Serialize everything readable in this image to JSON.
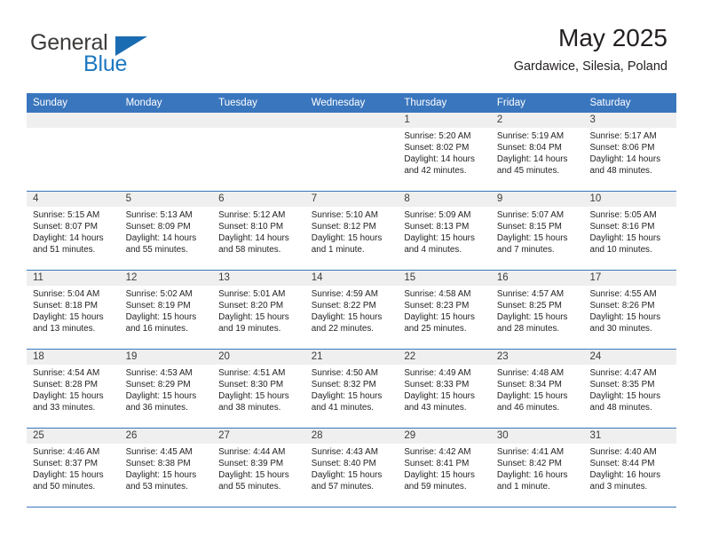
{
  "logo": {
    "word_one": "General",
    "word_two": "Blue",
    "icon": "blue-triangle"
  },
  "header": {
    "title": "May 2025",
    "subtitle": "Gardawice, Silesia, Poland"
  },
  "colors": {
    "header_blue": "#3a76bd",
    "date_band_gray": "#efefef",
    "logo_blue": "#1d78c1",
    "text": "#231f20"
  },
  "weekdays": [
    "Sunday",
    "Monday",
    "Tuesday",
    "Wednesday",
    "Thursday",
    "Friday",
    "Saturday"
  ],
  "weeks": [
    [
      {
        "day": "",
        "empty": true
      },
      {
        "day": "",
        "empty": true
      },
      {
        "day": "",
        "empty": true
      },
      {
        "day": "",
        "empty": true
      },
      {
        "day": "1",
        "sunrise": "Sunrise: 5:20 AM",
        "sunset": "Sunset: 8:02 PM",
        "daylight1": "Daylight: 14 hours",
        "daylight2": "and 42 minutes."
      },
      {
        "day": "2",
        "sunrise": "Sunrise: 5:19 AM",
        "sunset": "Sunset: 8:04 PM",
        "daylight1": "Daylight: 14 hours",
        "daylight2": "and 45 minutes."
      },
      {
        "day": "3",
        "sunrise": "Sunrise: 5:17 AM",
        "sunset": "Sunset: 8:06 PM",
        "daylight1": "Daylight: 14 hours",
        "daylight2": "and 48 minutes."
      }
    ],
    [
      {
        "day": "4",
        "sunrise": "Sunrise: 5:15 AM",
        "sunset": "Sunset: 8:07 PM",
        "daylight1": "Daylight: 14 hours",
        "daylight2": "and 51 minutes."
      },
      {
        "day": "5",
        "sunrise": "Sunrise: 5:13 AM",
        "sunset": "Sunset: 8:09 PM",
        "daylight1": "Daylight: 14 hours",
        "daylight2": "and 55 minutes."
      },
      {
        "day": "6",
        "sunrise": "Sunrise: 5:12 AM",
        "sunset": "Sunset: 8:10 PM",
        "daylight1": "Daylight: 14 hours",
        "daylight2": "and 58 minutes."
      },
      {
        "day": "7",
        "sunrise": "Sunrise: 5:10 AM",
        "sunset": "Sunset: 8:12 PM",
        "daylight1": "Daylight: 15 hours",
        "daylight2": "and 1 minute."
      },
      {
        "day": "8",
        "sunrise": "Sunrise: 5:09 AM",
        "sunset": "Sunset: 8:13 PM",
        "daylight1": "Daylight: 15 hours",
        "daylight2": "and 4 minutes."
      },
      {
        "day": "9",
        "sunrise": "Sunrise: 5:07 AM",
        "sunset": "Sunset: 8:15 PM",
        "daylight1": "Daylight: 15 hours",
        "daylight2": "and 7 minutes."
      },
      {
        "day": "10",
        "sunrise": "Sunrise: 5:05 AM",
        "sunset": "Sunset: 8:16 PM",
        "daylight1": "Daylight: 15 hours",
        "daylight2": "and 10 minutes."
      }
    ],
    [
      {
        "day": "11",
        "sunrise": "Sunrise: 5:04 AM",
        "sunset": "Sunset: 8:18 PM",
        "daylight1": "Daylight: 15 hours",
        "daylight2": "and 13 minutes."
      },
      {
        "day": "12",
        "sunrise": "Sunrise: 5:02 AM",
        "sunset": "Sunset: 8:19 PM",
        "daylight1": "Daylight: 15 hours",
        "daylight2": "and 16 minutes."
      },
      {
        "day": "13",
        "sunrise": "Sunrise: 5:01 AM",
        "sunset": "Sunset: 8:20 PM",
        "daylight1": "Daylight: 15 hours",
        "daylight2": "and 19 minutes."
      },
      {
        "day": "14",
        "sunrise": "Sunrise: 4:59 AM",
        "sunset": "Sunset: 8:22 PM",
        "daylight1": "Daylight: 15 hours",
        "daylight2": "and 22 minutes."
      },
      {
        "day": "15",
        "sunrise": "Sunrise: 4:58 AM",
        "sunset": "Sunset: 8:23 PM",
        "daylight1": "Daylight: 15 hours",
        "daylight2": "and 25 minutes."
      },
      {
        "day": "16",
        "sunrise": "Sunrise: 4:57 AM",
        "sunset": "Sunset: 8:25 PM",
        "daylight1": "Daylight: 15 hours",
        "daylight2": "and 28 minutes."
      },
      {
        "day": "17",
        "sunrise": "Sunrise: 4:55 AM",
        "sunset": "Sunset: 8:26 PM",
        "daylight1": "Daylight: 15 hours",
        "daylight2": "and 30 minutes."
      }
    ],
    [
      {
        "day": "18",
        "sunrise": "Sunrise: 4:54 AM",
        "sunset": "Sunset: 8:28 PM",
        "daylight1": "Daylight: 15 hours",
        "daylight2": "and 33 minutes."
      },
      {
        "day": "19",
        "sunrise": "Sunrise: 4:53 AM",
        "sunset": "Sunset: 8:29 PM",
        "daylight1": "Daylight: 15 hours",
        "daylight2": "and 36 minutes."
      },
      {
        "day": "20",
        "sunrise": "Sunrise: 4:51 AM",
        "sunset": "Sunset: 8:30 PM",
        "daylight1": "Daylight: 15 hours",
        "daylight2": "and 38 minutes."
      },
      {
        "day": "21",
        "sunrise": "Sunrise: 4:50 AM",
        "sunset": "Sunset: 8:32 PM",
        "daylight1": "Daylight: 15 hours",
        "daylight2": "and 41 minutes."
      },
      {
        "day": "22",
        "sunrise": "Sunrise: 4:49 AM",
        "sunset": "Sunset: 8:33 PM",
        "daylight1": "Daylight: 15 hours",
        "daylight2": "and 43 minutes."
      },
      {
        "day": "23",
        "sunrise": "Sunrise: 4:48 AM",
        "sunset": "Sunset: 8:34 PM",
        "daylight1": "Daylight: 15 hours",
        "daylight2": "and 46 minutes."
      },
      {
        "day": "24",
        "sunrise": "Sunrise: 4:47 AM",
        "sunset": "Sunset: 8:35 PM",
        "daylight1": "Daylight: 15 hours",
        "daylight2": "and 48 minutes."
      }
    ],
    [
      {
        "day": "25",
        "sunrise": "Sunrise: 4:46 AM",
        "sunset": "Sunset: 8:37 PM",
        "daylight1": "Daylight: 15 hours",
        "daylight2": "and 50 minutes."
      },
      {
        "day": "26",
        "sunrise": "Sunrise: 4:45 AM",
        "sunset": "Sunset: 8:38 PM",
        "daylight1": "Daylight: 15 hours",
        "daylight2": "and 53 minutes."
      },
      {
        "day": "27",
        "sunrise": "Sunrise: 4:44 AM",
        "sunset": "Sunset: 8:39 PM",
        "daylight1": "Daylight: 15 hours",
        "daylight2": "and 55 minutes."
      },
      {
        "day": "28",
        "sunrise": "Sunrise: 4:43 AM",
        "sunset": "Sunset: 8:40 PM",
        "daylight1": "Daylight: 15 hours",
        "daylight2": "and 57 minutes."
      },
      {
        "day": "29",
        "sunrise": "Sunrise: 4:42 AM",
        "sunset": "Sunset: 8:41 PM",
        "daylight1": "Daylight: 15 hours",
        "daylight2": "and 59 minutes."
      },
      {
        "day": "30",
        "sunrise": "Sunrise: 4:41 AM",
        "sunset": "Sunset: 8:42 PM",
        "daylight1": "Daylight: 16 hours",
        "daylight2": "and 1 minute."
      },
      {
        "day": "31",
        "sunrise": "Sunrise: 4:40 AM",
        "sunset": "Sunset: 8:44 PM",
        "daylight1": "Daylight: 16 hours",
        "daylight2": "and 3 minutes."
      }
    ]
  ]
}
